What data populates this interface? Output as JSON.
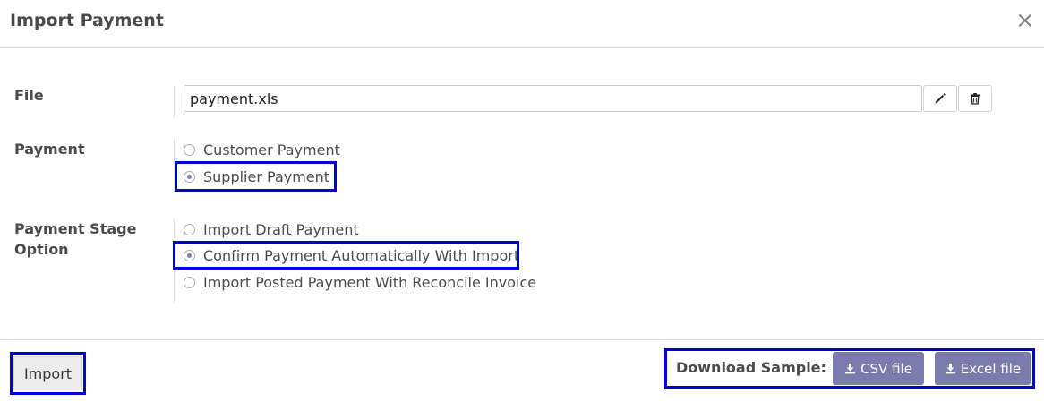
{
  "dialog": {
    "title": "Import Payment",
    "close_glyph": "×"
  },
  "file": {
    "label": "File",
    "value": "payment.xls",
    "edit_icon": "pencil-icon",
    "delete_icon": "trash-icon"
  },
  "payment": {
    "label": "Payment",
    "options": [
      {
        "label": "Customer Payment",
        "checked": false
      },
      {
        "label": "Supplier Payment",
        "checked": true
      }
    ]
  },
  "stage": {
    "label_line1": "Payment Stage",
    "label_line2": "Option",
    "options": [
      {
        "label": "Import Draft Payment",
        "checked": false
      },
      {
        "label": "Confirm Payment Automatically With Import",
        "checked": true
      },
      {
        "label": "Import Posted Payment With Reconcile Invoice",
        "checked": false
      }
    ]
  },
  "footer": {
    "import_label": "Import",
    "download_label": "Download Sample:",
    "csv_label": "CSV file",
    "excel_label": "Excel file",
    "download_icon": "download-icon"
  },
  "colors": {
    "accent": "#7c7bad",
    "highlight": "#0000dd"
  }
}
